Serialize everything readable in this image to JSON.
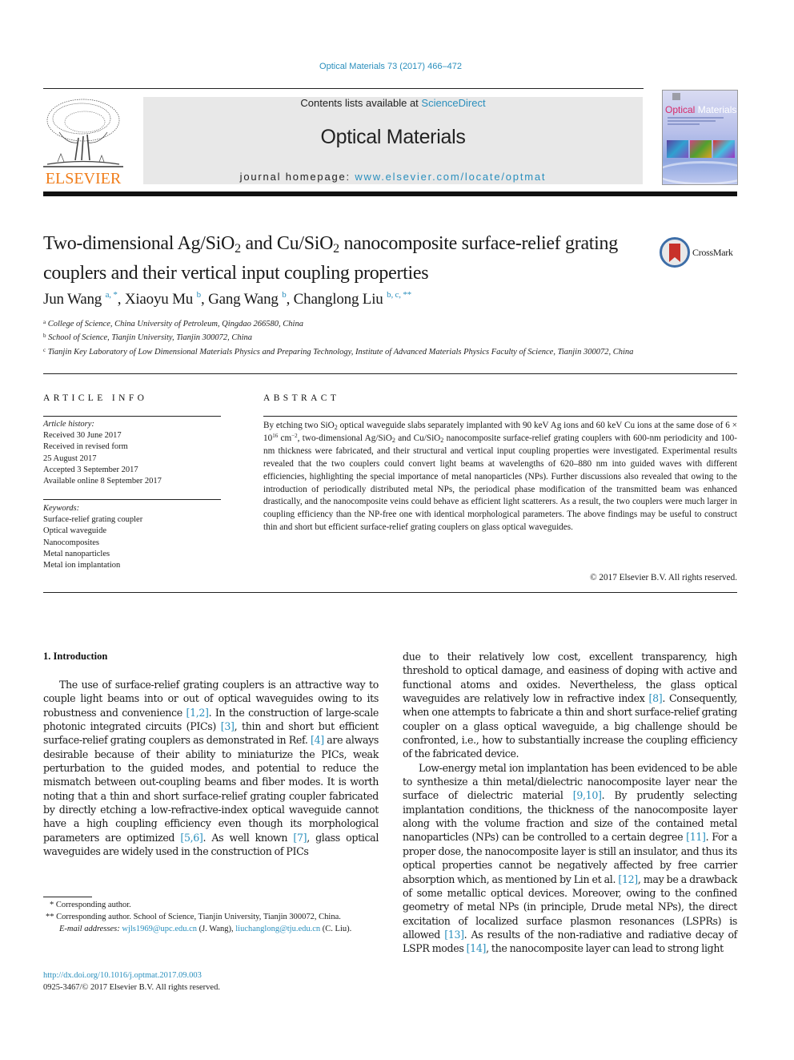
{
  "header": {
    "citation": "Optical Materials 73 (2017) 466–472",
    "contents_prefix": "Contents lists available at ",
    "contents_link": "ScienceDirect",
    "journal_title": "Optical Materials",
    "homepage_prefix": "journal homepage: ",
    "homepage_link": "www.elsevier.com/locate/optmat",
    "publisher_logo_text": "ELSEVIER",
    "cover_title_a": "Optical",
    "cover_title_b": "Materials",
    "crossmark_label": "CrossMark"
  },
  "article": {
    "title_parts": [
      "Two-dimensional Ag/SiO",
      "2",
      " and Cu/SiO",
      "2",
      " nanocomposite surface-relief grating couplers and their vertical input coupling properties"
    ],
    "authors": [
      {
        "name": "Jun Wang",
        "sup": "a, *"
      },
      {
        "name": "Xiaoyu Mu",
        "sup": "b"
      },
      {
        "name": "Gang Wang",
        "sup": "b"
      },
      {
        "name": "Changlong Liu",
        "sup": "b, c, **"
      }
    ],
    "affiliations": [
      {
        "key": "a",
        "text": "College of Science, China University of Petroleum, Qingdao 266580, China"
      },
      {
        "key": "b",
        "text": "School of Science, Tianjin University, Tianjin 300072, China"
      },
      {
        "key": "c",
        "text": "Tianjin Key Laboratory of Low Dimensional Materials Physics and Preparing Technology, Institute of Advanced Materials Physics Faculty of Science, Tianjin 300072, China"
      }
    ]
  },
  "article_info": {
    "heading": "ARTICLE INFO",
    "history_label": "Article history:",
    "history": [
      "Received 30 June 2017",
      "Received in revised form",
      "25 August 2017",
      "Accepted 3 September 2017",
      "Available online 8 September 2017"
    ],
    "keywords_label": "Keywords:",
    "keywords": [
      "Surface-relief grating coupler",
      "Optical waveguide",
      "Nanocomposites",
      "Metal nanoparticles",
      "Metal ion implantation"
    ]
  },
  "abstract": {
    "heading": "ABSTRACT",
    "p1": "By etching two SiO",
    "p2": " optical waveguide slabs separately implanted with 90 keV Ag ions and 60 keV Cu ions at the same dose of 6 × 10",
    "p3": "16",
    "p4": " cm",
    "p5": "−2",
    "p6": ", two-dimensional Ag/SiO",
    "p7": " and Cu/SiO",
    "p8": " nanocomposite surface-relief grating couplers with 600-nm periodicity and 100-nm thickness were fabricated, and their structural and vertical input coupling properties were investigated. Experimental results revealed that the two couplers could convert light beams at wavelengths of 620–880 nm into guided waves with different efficiencies, highlighting the special importance of metal nanoparticles (NPs). Further discussions also revealed that owing to the introduction of periodically distributed metal NPs, the periodical phase modification of the transmitted beam was enhanced drastically, and the nanocomposite veins could behave as efficient light scatterers. As a result, the two couplers were much larger in coupling efficiency than the NP-free one with identical morphological parameters. The above findings may be useful to construct thin and short but efficient surface-relief grating couplers on glass optical waveguides.",
    "sub2": "2",
    "copyright": "© 2017 Elsevier B.V. All rights reserved."
  },
  "intro": {
    "heading": "1.  Introduction",
    "left": {
      "t1": "The use of surface-relief grating couplers is an attractive way to couple light beams into or out of optical waveguides owing to its robustness and convenience ",
      "r1": "[1,2]",
      "t2": ". In the construction of large-scale photonic integrated circuits (PICs) ",
      "r2": "[3]",
      "t3": ", thin and short but efficient surface-relief grating couplers as demonstrated in Ref. ",
      "r3": "[4]",
      "t4": " are always desirable because of their ability to miniaturize the PICs, weak perturbation to the guided modes, and potential to reduce the mismatch between out-coupling beams and fiber modes. It is worth noting that a thin and short surface-relief grating coupler fabricated by directly etching a low-refractive-index optical waveguide cannot have a high coupling efficiency even though its morphological parameters are optimized ",
      "r4": "[5,6]",
      "t5": ". As well known ",
      "r5": "[7]",
      "t6": ", glass optical waveguides are widely used in the construction of PICs"
    },
    "right": {
      "t1": "due to their relatively low cost, excellent transparency, high threshold to optical damage, and easiness of doping with active and functional atoms and oxides. Nevertheless, the glass optical waveguides are relatively low in refractive index ",
      "r1": "[8]",
      "t2": ". Consequently, when one attempts to fabricate a thin and short surface-relief grating coupler on a glass optical waveguide, a big challenge should be confronted, i.e., how to substantially increase the coupling efficiency of the fabricated device.",
      "p2_t1": "Low-energy metal ion implantation has been evidenced to be able to synthesize a thin metal/dielectric nanocomposite layer near the surface of dielectric material ",
      "p2_r1": "[9,10]",
      "p2_t2": ". By prudently selecting implantation conditions, the thickness of the nanocomposite layer along with the volume fraction and size of the contained metal nanoparticles (NPs) can be controlled to a certain degree ",
      "p2_r2": "[11]",
      "p2_t3": ". For a proper dose, the nanocomposite layer is still an insulator, and thus its optical properties cannot be negatively affected by free carrier absorption which, as mentioned by Lin et al. ",
      "p2_r3": "[12]",
      "p2_t4": ", may be a drawback of some metallic optical devices. Moreover, owing to the confined geometry of metal NPs (in principle, Drude metal NPs), the direct excitation of localized surface plasmon resonances (LSPRs) is allowed ",
      "p2_r4": "[13]",
      "p2_t5": ". As results of the non-radiative and radiative decay of LSPR modes ",
      "p2_r5": "[14]",
      "p2_t6": ", the nanocomposite layer can lead to strong light"
    }
  },
  "footnotes": {
    "fn1": "* Corresponding author.",
    "fn2": "** Corresponding author. School of Science, Tianjin University, Tianjin 300072, China.",
    "email_label": "E-mail addresses:",
    "email1": "wjls1969@upc.edu.cn",
    "email1_owner": " (J. Wang), ",
    "email2": "liuchanglong@tju.edu.cn",
    "email2_owner": " (C. Liu).",
    "doi": "http://dx.doi.org/10.1016/j.optmat.2017.09.003",
    "issn": "0925-3467/© 2017 Elsevier B.V. All rights reserved."
  },
  "colors": {
    "link": "#2a8fbd",
    "elsevier_orange": "#f07d1a",
    "banner_bg": "#e8e8e8"
  }
}
